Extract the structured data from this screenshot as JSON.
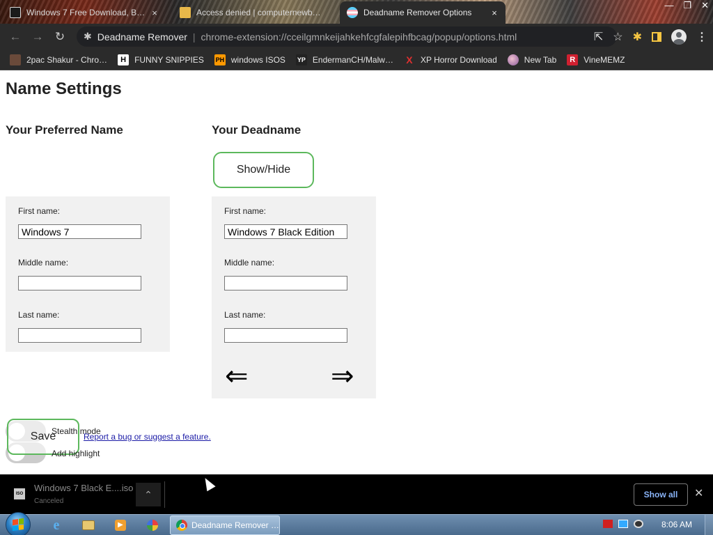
{
  "browser": {
    "tabs": [
      {
        "title": "Windows 7 Free Download, Bo…",
        "active": false,
        "close": "×"
      },
      {
        "title": "Access denied | computernewb…",
        "active": false,
        "close": "×"
      },
      {
        "title": "Deadname Remover Options",
        "active": true,
        "close": "×"
      }
    ],
    "window_controls": [
      "—",
      "❐",
      "✕"
    ],
    "omnibox": {
      "extension_name": "Deadname Remover",
      "url": "chrome-extension://cceilgmnkeijahkehfcgfalepihfbcag/popup/options.html"
    },
    "bookmarks": [
      {
        "label": "2pac Shakur - Chro…",
        "icon": "2pac-icon"
      },
      {
        "label": "FUNNY SNIPPIES",
        "icon": "H"
      },
      {
        "label": "windows ISOS",
        "icon": "PH"
      },
      {
        "label": "EndermanCH/Malw…",
        "icon": "YP"
      },
      {
        "label": "XP Horror Download",
        "icon": "X"
      },
      {
        "label": "New Tab",
        "icon": "globe-icon"
      },
      {
        "label": "VineMEMZ",
        "icon": "R"
      }
    ]
  },
  "page": {
    "title": "Name Settings",
    "preferred": {
      "heading": "Your Preferred Name",
      "first_label": "First name:",
      "first_value": "Windows 7",
      "middle_label": "Middle name:",
      "middle_value": "",
      "last_label": "Last name:",
      "last_value": ""
    },
    "deadname": {
      "heading": "Your Deadname",
      "show_hide": "Show/Hide",
      "first_label": "First name:",
      "first_value": "Windows 7 Black Edition",
      "middle_label": "Middle name:",
      "middle_value": "",
      "last_label": "Last name:",
      "last_value": "",
      "prev_arrow": "⇐",
      "next_arrow": "⇒"
    },
    "save_label": "Save",
    "stealth_label": "Stealth mode",
    "highlight_label": "Add highlight",
    "bug_link": "Report a bug or suggest a feature."
  },
  "downloads": {
    "file_name": "Windows 7 Black E....iso",
    "status": "Canceled",
    "file_icon_text": "ISO",
    "show_all": "Show all",
    "more": "⌃",
    "close": "✕"
  },
  "taskbar": {
    "active_task": "Deadname Remover …",
    "clock": "8:06 AM"
  },
  "colors": {
    "accent_green": "#5cb85c",
    "panel_bg": "#f1f1f1",
    "chrome_dark": "#2b2b2b",
    "link": "#1a1aa6"
  }
}
